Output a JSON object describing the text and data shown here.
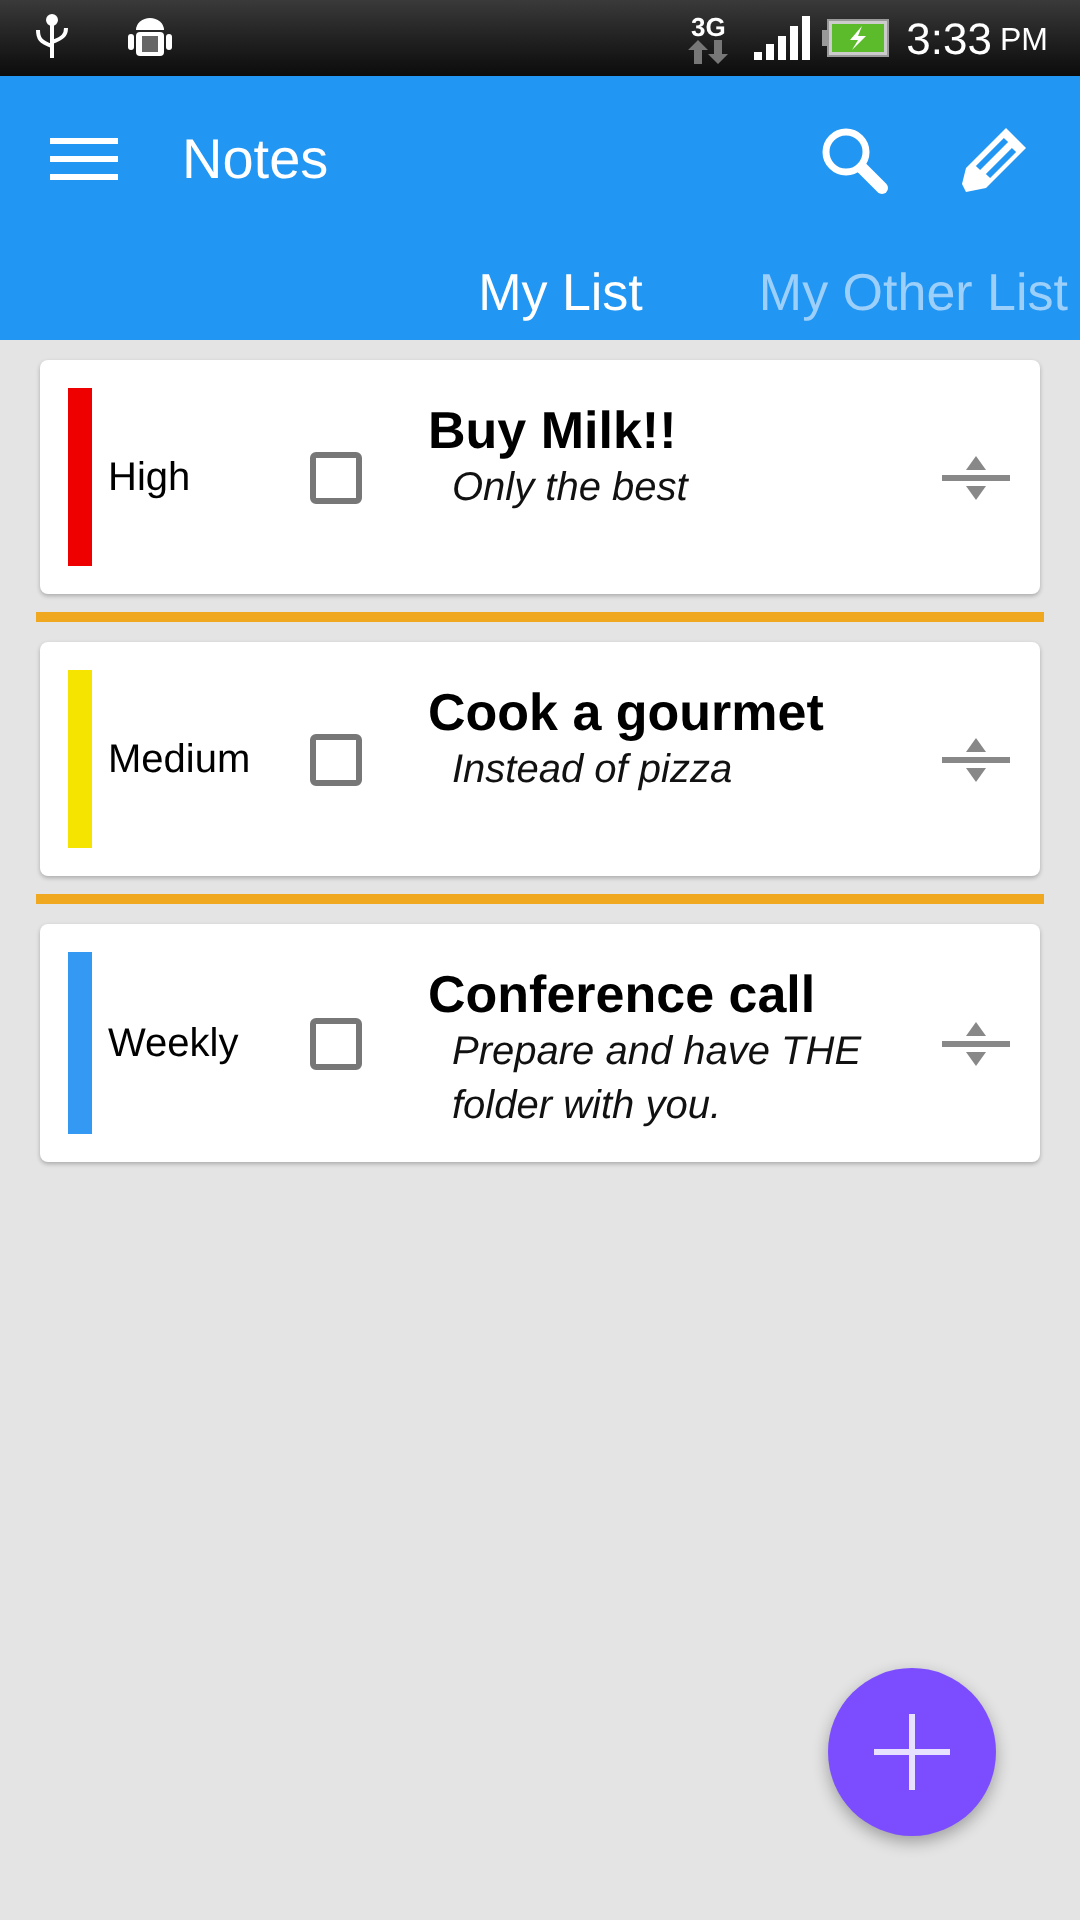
{
  "status_bar": {
    "network": "3G",
    "time": "3:33",
    "period": "PM"
  },
  "app_bar": {
    "title": "Notes"
  },
  "tabs": [
    {
      "label": "My List",
      "selected": true
    },
    {
      "label": "My Other List",
      "selected": false
    }
  ],
  "notes": [
    {
      "priority": "High",
      "color": "#ee0000",
      "checked": false,
      "title": "Buy Milk!!",
      "note": "Only the best"
    },
    {
      "priority": "Medium",
      "color": "#f5e400",
      "checked": false,
      "title": "Cook a gourmet",
      "note": "Instead of pizza"
    },
    {
      "priority": "Weekly",
      "color": "#3399f3",
      "checked": false,
      "title": "Conference call",
      "note": "Prepare and have THE folder with you."
    }
  ]
}
